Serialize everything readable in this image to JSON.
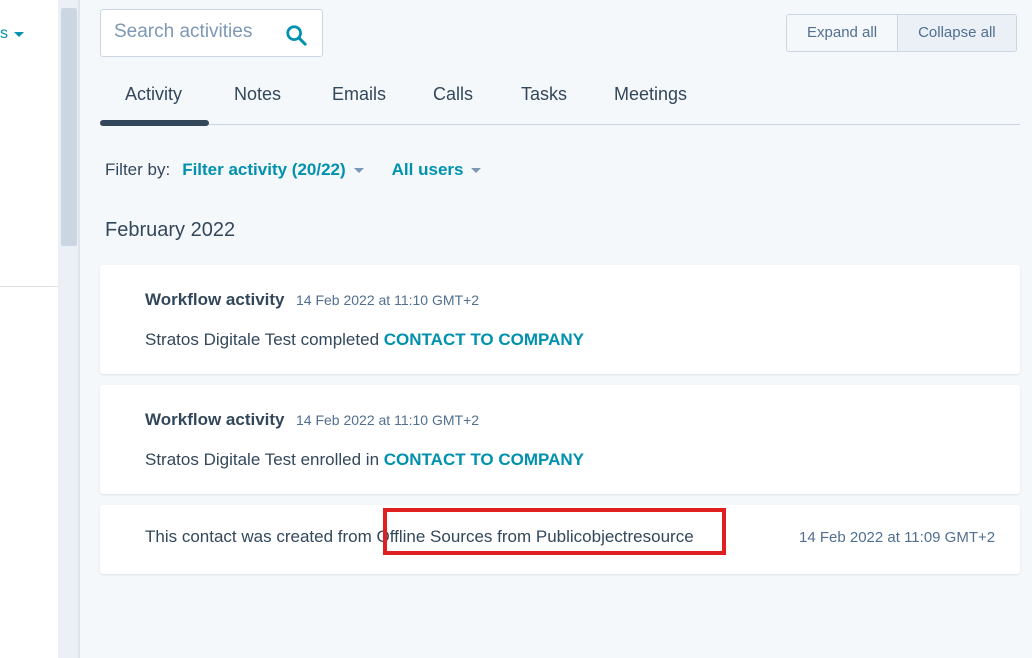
{
  "left_panel": {
    "link_fragment": "s"
  },
  "search": {
    "placeholder": "Search activities",
    "value": ""
  },
  "toolbar": {
    "expand_label": "Expand all",
    "collapse_label": "Collapse all"
  },
  "tabs": [
    {
      "label": "Activity",
      "active": true
    },
    {
      "label": "Notes"
    },
    {
      "label": "Emails"
    },
    {
      "label": "Calls"
    },
    {
      "label": "Tasks"
    },
    {
      "label": "Meetings"
    }
  ],
  "filters": {
    "label": "Filter by:",
    "activity": "Filter activity (20/22)",
    "users": "All users"
  },
  "month_heading": "February 2022",
  "activities": [
    {
      "title": "Workflow activity",
      "time": "14 Feb 2022 at 11:10 GMT+2",
      "body_prefix": "Stratos Digitale Test completed",
      "body_link": "CONTACT TO COMPANY"
    },
    {
      "title": "Workflow activity",
      "time": "14 Feb 2022 at 11:10 GMT+2",
      "body_prefix": "Stratos Digitale Test enrolled in",
      "body_link": "CONTACT TO COMPANY"
    }
  ],
  "created": {
    "prefix": "This contact was created from",
    "source": "Offline Sources from Publicobjectresource",
    "time": "14 Feb 2022 at 11:09 GMT+2"
  },
  "colors": {
    "accent": "#0091ae",
    "text": "#33475b",
    "highlight": "#e02020"
  }
}
